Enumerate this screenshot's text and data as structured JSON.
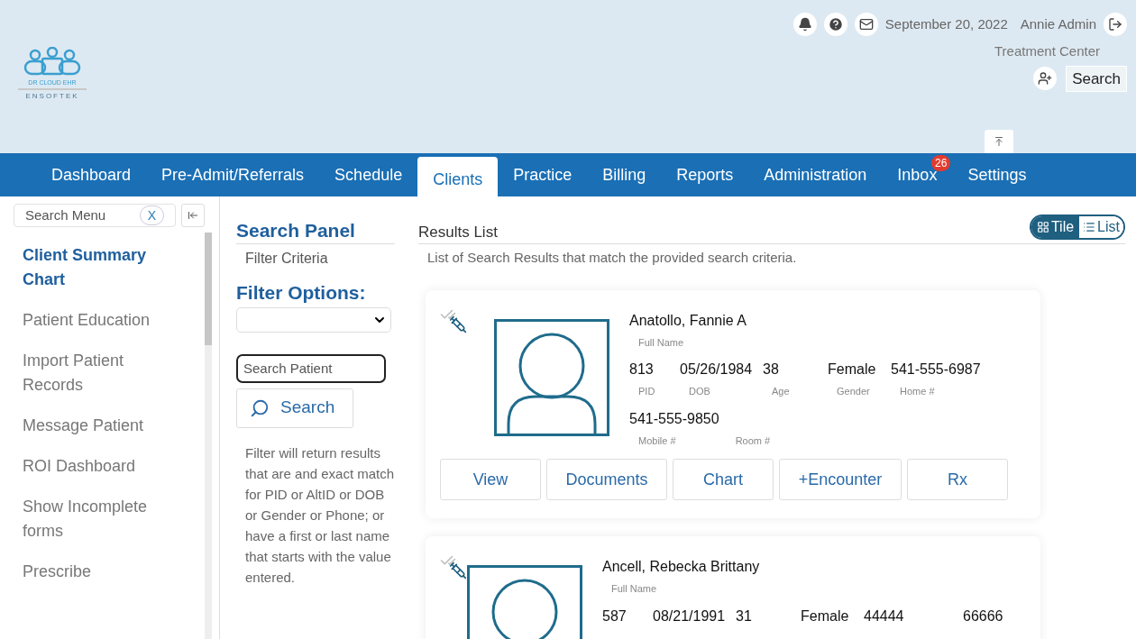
{
  "logo": {
    "tagline": "DR CLOUD EHR",
    "brand": "ENSOFTEK"
  },
  "header": {
    "date": "September 20, 2022",
    "user": "Annie Admin",
    "location": "Treatment Center",
    "search_button": "Search"
  },
  "nav": [
    {
      "label": "Dashboard",
      "selected": false
    },
    {
      "label": "Pre-Admit/Referrals",
      "selected": false
    },
    {
      "label": "Schedule",
      "selected": false
    },
    {
      "label": "Clients",
      "selected": true
    },
    {
      "label": "Practice",
      "selected": false
    },
    {
      "label": "Billing",
      "selected": false
    },
    {
      "label": "Reports",
      "selected": false
    },
    {
      "label": "Administration",
      "selected": false
    },
    {
      "label": "Inbox",
      "selected": false,
      "badge": "26"
    },
    {
      "label": "Settings",
      "selected": false
    }
  ],
  "sidebar": {
    "search_placeholder": "Search Menu",
    "clear": "X",
    "items": [
      {
        "label": "Client Summary Chart",
        "selected": true
      },
      {
        "label": "Patient Education",
        "selected": false
      },
      {
        "label": "Import Patient Records",
        "selected": false
      },
      {
        "label": "Message Patient",
        "selected": false
      },
      {
        "label": "ROI Dashboard",
        "selected": false
      },
      {
        "label": "Show Incomplete forms",
        "selected": false
      },
      {
        "label": "Prescribe",
        "selected": false
      }
    ]
  },
  "search_panel": {
    "title": "Search Panel",
    "subtitle": "Filter Criteria",
    "filter_title": "Filter Options:",
    "patient_placeholder": "Search Patient",
    "search_button": "Search",
    "help": "Filter will return results that are and exact match for PID or AltID or DOB or Gender or Phone; or have a first or last name that starts with the value entered."
  },
  "results": {
    "title": "Results List",
    "description": "List of Search Results that match the provided search criteria.",
    "views": [
      {
        "label": "Tile",
        "selected": true
      },
      {
        "label": "List",
        "selected": false
      }
    ],
    "clients": [
      {
        "name": "Anatollo, Fannie A",
        "name_label": "Full Name",
        "rows": [
          [
            {
              "value": "813",
              "label": "PID"
            },
            {
              "value": "05/26/1984",
              "label": "DOB"
            },
            {
              "value": "38",
              "label": "Age"
            },
            {
              "value": "Female",
              "label": "Gender"
            },
            {
              "value": "541-555-6987",
              "label": "Home #"
            }
          ],
          [
            {
              "value": "541-555-9850",
              "label": "Mobile #"
            },
            {
              "label": "Room #"
            }
          ]
        ],
        "actions": [
          "View",
          "Documents",
          "Chart",
          "+Encounter",
          "Rx"
        ]
      },
      {
        "name": "Ancell, Rebecka Brittany",
        "name_label": "Full Name",
        "rows": [
          [
            {
              "value": "587"
            },
            {
              "value": "08/21/1991"
            },
            {
              "value": "31"
            },
            {
              "value": "Female"
            },
            {
              "value": "44444"
            },
            {
              "value": "66666"
            }
          ]
        ]
      }
    ]
  }
}
